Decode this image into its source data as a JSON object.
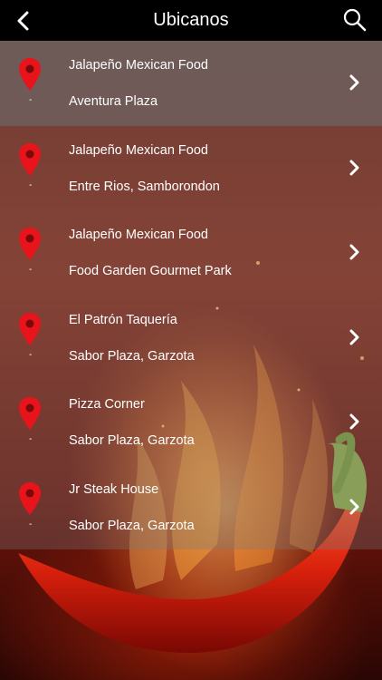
{
  "header": {
    "title": "Ubicanos",
    "back_icon": "chevron-left-icon",
    "search_icon": "search-icon"
  },
  "locations": [
    {
      "name": "Jalapeño Mexican Food",
      "place": "Aventura Plaza",
      "marker": "-"
    },
    {
      "name": "Jalapeño Mexican Food",
      "place": "Entre Rios, Samborondon",
      "marker": "-"
    },
    {
      "name": "Jalapeño Mexican Food",
      "place": "Food Garden Gourmet Park",
      "marker": "-"
    },
    {
      "name": "El Patrón Taquería",
      "place": "Sabor Plaza, Garzota",
      "marker": "-"
    },
    {
      "name": "Pizza Corner",
      "place": "Sabor Plaza, Garzota",
      "marker": "-"
    },
    {
      "name": "Jr Steak House",
      "place": "Sabor Plaza, Garzota",
      "marker": "-"
    }
  ],
  "colors": {
    "header_bg": "#000000",
    "pin": "#e8141c",
    "text": "#ffffff"
  }
}
